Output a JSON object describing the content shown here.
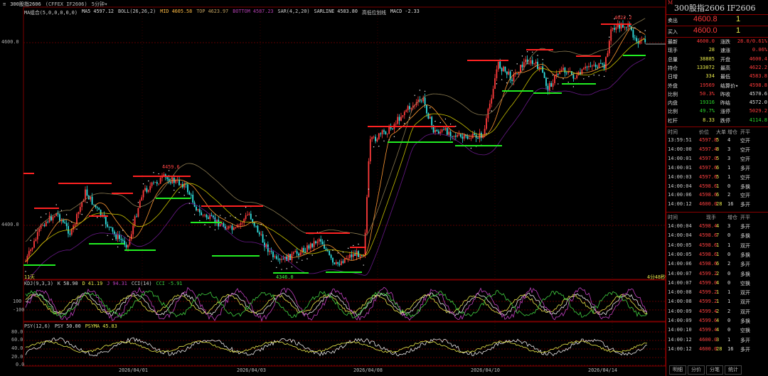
{
  "toolbar": {
    "menu_glyph": "≡",
    "symbol": "300股指2606",
    "contract": "(CFFEX IF2606)",
    "period": "5分钟",
    "period_arrow": "▾"
  },
  "main_indicators": [
    {
      "text": "MA组合(5,0,0,0,0,0)",
      "color": "#cccccc"
    },
    {
      "text": "MA5 4597.12",
      "color": "#dddddd"
    },
    {
      "text": "BOLL(26,26,2)",
      "color": "#cccccc"
    },
    {
      "text": "MID 4605.58",
      "color": "#ffbb44"
    },
    {
      "text": "TOP 4623.97",
      "color": "#c0a060"
    },
    {
      "text": "BOTTOM 4587.23",
      "color": "#b040b0"
    },
    {
      "text": "SAR(4,2,20)",
      "color": "#cccccc"
    },
    {
      "text": "SARLINE 4583.80",
      "color": "#dddddd"
    },
    {
      "text": "高低位划线",
      "color": "#cccccc"
    },
    {
      "text": "MACD -2.33",
      "color": "#dddddd"
    }
  ],
  "kdj_indicators": [
    {
      "text": "KDJ(9,3,3)",
      "color": "#cccccc"
    },
    {
      "text": "K 58.90",
      "color": "#dddddd"
    },
    {
      "text": "D 41.19",
      "color": "#e8e84a"
    },
    {
      "text": "J 94.31",
      "color": "#c040c0"
    },
    {
      "text": "CCI(14)",
      "color": "#cccccc"
    },
    {
      "text": "CCI -5.91",
      "color": "#40d040"
    }
  ],
  "psy_indicators": [
    {
      "text": "PSY(12,6)",
      "color": "#cccccc"
    },
    {
      "text": "PSY 50.00",
      "color": "#dddddd"
    },
    {
      "text": "PSYMA 45.83",
      "color": "#e8e84a"
    }
  ],
  "price_axis": [
    "4600.0",
    "4400.0"
  ],
  "kdj_axis": [
    "100",
    "-100"
  ],
  "psy_axis": [
    "80.0",
    "60.0",
    "40.0",
    "20.0",
    "0.0"
  ],
  "dates": [
    "2026/04/01",
    "2026/04/03",
    "2026/04/08",
    "2026/04/10",
    "2026/04/14"
  ],
  "chart_labels": {
    "high_left": "4459.6",
    "low_mid": "4346.0",
    "high_right": "4622.2",
    "left_marker": "11天",
    "right_marker": "4分48秒"
  },
  "colors": {
    "up": "#ff3b3b",
    "down": "#30e0e0",
    "grid": "#5a0000",
    "sar": "#ffffff",
    "support": "#22ee22",
    "resist": "#ff2222"
  },
  "quote": {
    "title": "300股指2606  IF2606",
    "sell": {
      "label": "卖出",
      "price": "4600.8",
      "vol": "1"
    },
    "buy": {
      "label": "买入",
      "price": "4600.0",
      "vol": "1"
    }
  },
  "stats": [
    {
      "l": "最新",
      "v": "4600.0",
      "vc": "red",
      "l2": "涨跌",
      "v2": "28.0/0.61%",
      "v2c": "red"
    },
    {
      "l": "现手",
      "v": "28",
      "vc": "yel",
      "l2": "速涨",
      "v2": "0.06%",
      "v2c": "red"
    },
    {
      "l": "总量",
      "v": "38885",
      "vc": "yel",
      "l2": "开盘",
      "v2": "4600.4",
      "v2c": "red"
    },
    {
      "l": "持仓",
      "v": "133072",
      "vc": "yel",
      "l2": "最高",
      "v2": "4622.2",
      "v2c": "red"
    },
    {
      "l": "日增",
      "v": "334",
      "vc": "yel",
      "l2": "最低",
      "v2": "4583.8",
      "v2c": "red"
    },
    {
      "l": "外盘",
      "v": "19569",
      "vc": "red",
      "l2": "结算价▾",
      "v2": "4598.8",
      "v2c": "red"
    },
    {
      "l": "比例",
      "v": "50.3%",
      "vc": "red",
      "l2": "昨收",
      "v2": "4570.6",
      "v2c": "wht"
    },
    {
      "l": "内盘",
      "v": "19316",
      "vc": "grn",
      "l2": "昨结",
      "v2": "4572.0",
      "v2c": "wht"
    },
    {
      "l": "比例",
      "v": "49.7%",
      "vc": "grn",
      "l2": "涨停",
      "v2": "5029.2",
      "v2c": "red"
    },
    {
      "l": "杠杆",
      "v": "8.33",
      "vc": "yel",
      "l2": "跌停",
      "v2": "4114.8",
      "v2c": "grn"
    }
  ],
  "trades_header": [
    "时间",
    "价位",
    "大单",
    "增仓",
    "开平"
  ],
  "trades_a": [
    [
      "13:59:51",
      "4597.8",
      "5",
      "4",
      "空开"
    ],
    [
      "14:00:00",
      "4597.4",
      "8",
      "3",
      "空开"
    ],
    [
      "14:00:01",
      "4597.0",
      "5",
      "3",
      "空开"
    ],
    [
      "14:00:01",
      "4597.6",
      "6",
      "1",
      "多开"
    ],
    [
      "14:00:03",
      "4597.6",
      "5",
      "1",
      "空开"
    ],
    [
      "14:00:04",
      "4598.6",
      "1",
      "0",
      "多换"
    ],
    [
      "14:00:06",
      "4598.6",
      "6",
      "2",
      "空开"
    ],
    [
      "14:00:12",
      "4600.0",
      "28",
      "16",
      "多开"
    ]
  ],
  "trades_header2": [
    "时间",
    "现手",
    "增仓",
    "开平"
  ],
  "trades_b": [
    [
      "14:00:04",
      "4598.4",
      "4",
      "3",
      "多开"
    ],
    [
      "14:00:04",
      "4598.6",
      "7",
      "0",
      "多换"
    ],
    [
      "14:00:05",
      "4598.6",
      "1",
      "1",
      "双开"
    ],
    [
      "14:00:05",
      "4598.6",
      "1",
      "0",
      "多换"
    ],
    [
      "14:00:06",
      "4598.6",
      "6",
      "2",
      "多开"
    ],
    [
      "14:00:07",
      "4599.2",
      "2",
      "0",
      "多换"
    ],
    [
      "14:00:07",
      "4599.0",
      "4",
      "0",
      "空换"
    ],
    [
      "14:00:08",
      "4599.2",
      "1",
      "1",
      "双开"
    ],
    [
      "14:00:08",
      "4599.2",
      "1",
      "1",
      "双开"
    ],
    [
      "14:00:09",
      "4599.4",
      "2",
      "2",
      "双开"
    ],
    [
      "14:00:09",
      "4599.6",
      "4",
      "0",
      "多换"
    ],
    [
      "14:00:10",
      "4599.4",
      "4",
      "0",
      "空换"
    ],
    [
      "14:00:12",
      "4600.0",
      "3",
      "1",
      "多开"
    ],
    [
      "14:00:12",
      "4600.0",
      "28",
      "16",
      "多开"
    ]
  ],
  "tabs": [
    "明细",
    "分价",
    "分笔",
    "统计"
  ]
}
